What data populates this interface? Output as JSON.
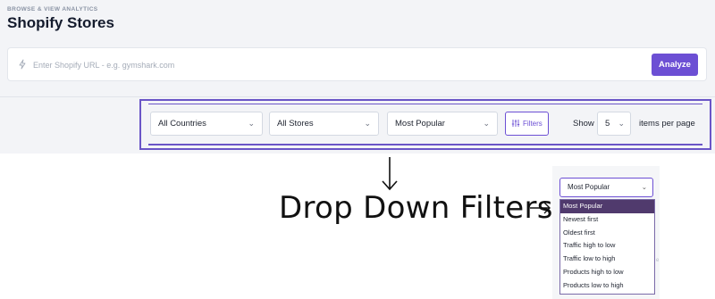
{
  "header": {
    "eyebrow": "BROWSE & VIEW ANALYTICS",
    "title": "Shopify Stores"
  },
  "search": {
    "placeholder": "Enter Shopify URL - e.g. gymshark.com",
    "icon": "bolt-icon",
    "button_label": "Analyze"
  },
  "colors": {
    "accent": "#6c4fd4",
    "highlight_frame": "#6a55c7",
    "selected_option_bg": "#503a6d"
  },
  "filters": {
    "country": "All Countries",
    "store": "All Stores",
    "sort": "Most Popular",
    "filters_button": "Filters",
    "filters_icon": "sliders-icon",
    "show_label": "Show",
    "page_size": "5",
    "per_page_label": "items per page"
  },
  "annotation": {
    "text": "Drop Down Filters"
  },
  "dropdown": {
    "selected": "Most Popular",
    "options": [
      "Most Popular",
      "Newest first",
      "Oldest first",
      "Traffic high to low",
      "Traffic low to high",
      "Products high to low",
      "Products low to high"
    ]
  }
}
